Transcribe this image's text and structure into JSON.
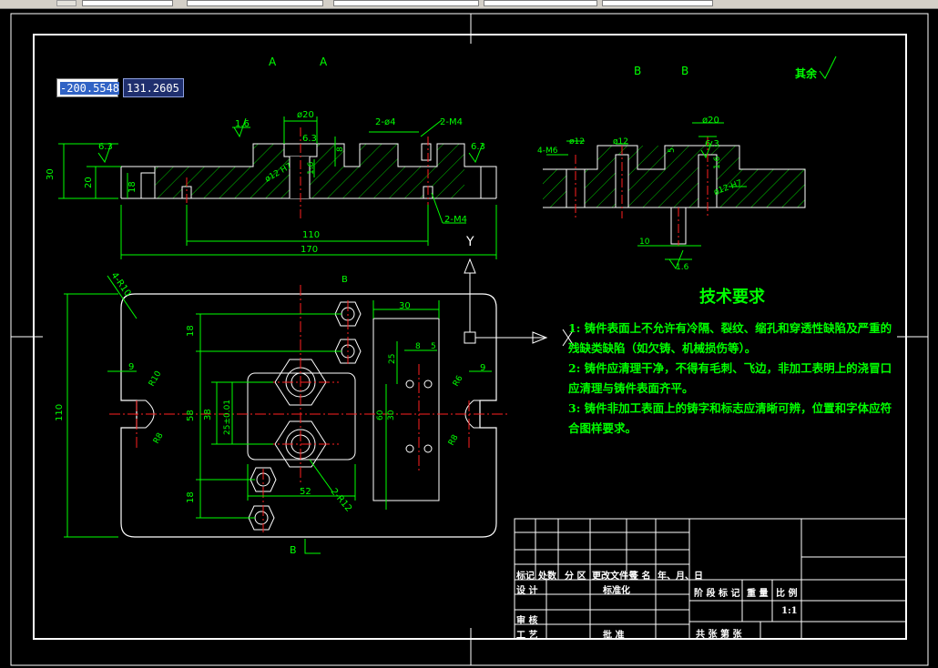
{
  "coords": {
    "x": "-200.5548",
    "y": "131.2605"
  },
  "section_labels": {
    "a1": "A",
    "a2": "A",
    "b1": "B",
    "b2": "B",
    "b_bottom": "B"
  },
  "roughness_note": "其余",
  "top_view_dims": {
    "d20": "ø20",
    "r16": "1.6",
    "r63a": "6.3",
    "r63b": "6.3",
    "r63c": "6.3",
    "h8": "8",
    "holes4": "2-ø4",
    "m4top": "2-M4",
    "m4bot": "2-M4",
    "h30": "30",
    "h20": "20",
    "h18": "18",
    "w110": "110",
    "w170": "170",
    "d12": "ø12 H7",
    "r16b": "1.6"
  },
  "right_view_dims": {
    "m6": "4-M6",
    "d12": "ø12",
    "d12b": "ø12",
    "d20": "ø20",
    "r63": "6.3",
    "h5": "5",
    "r16": "1.6",
    "d12h7": "ø12 H7",
    "tol": "10",
    "r16b": "1.6"
  },
  "plan_view_dims": {
    "r10corner": "4-R10",
    "w9": "9",
    "r10": "R10",
    "r8": "R8",
    "h18top": "18",
    "h58": "58",
    "h38": "38",
    "h25": "25±0.01",
    "h18bot": "18",
    "w52": "52",
    "r12": "2-R12",
    "h110": "110",
    "w30": "30",
    "h25r": "25",
    "w8": "8",
    "w5": "5",
    "h30r": "30",
    "h60": "60",
    "w9r": "9",
    "r8b": "R8",
    "r6": "R6",
    "axis_y": "Y"
  },
  "tech": {
    "title": "技术要求",
    "item1": "1: 铸件表面上不允许有冷隔、裂纹、缩孔和穿透性缺陷及严重的残缺类缺陷（如欠铸、机械损伤等）。",
    "item2": "2: 铸件应清理干净，不得有毛刺、飞边，非加工表明上的浇冒口应清理与铸件表面齐平。",
    "item3": "3: 铸件非加工表面上的铸字和标志应清晰可辨，位置和字体应符合图样要求。"
  },
  "title_block": {
    "mark": "标记",
    "count": "处数",
    "zone": "分 区",
    "doc": "更改文件号",
    "sign": "签 名",
    "date": "年、月、日",
    "design": "设 计",
    "standard": "标准化",
    "review": "审 核",
    "process": "工 艺",
    "approve": "批 准",
    "stage": "阶 段 标 记",
    "weight": "重 量",
    "scale": "比 例",
    "ratio": "1:1",
    "sheets": "共    张    第    张"
  },
  "colors": {
    "green": "#00ff00",
    "white": "#ffffff",
    "red": "#ff2020",
    "yellow": "#ffff00"
  }
}
